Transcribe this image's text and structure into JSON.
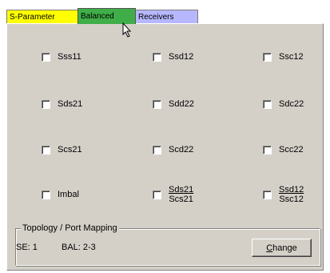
{
  "tabs": [
    {
      "label": "S-Parameter",
      "color": "#ffff00"
    },
    {
      "label": "Balanced",
      "color": "#3fae49",
      "selected": true
    },
    {
      "label": "Receivers",
      "color": "#b7b7ff"
    }
  ],
  "checkboxes": [
    {
      "label": "Sss11",
      "checked": false
    },
    {
      "label": "Ssd12",
      "checked": false
    },
    {
      "label": "Ssc12",
      "checked": false
    },
    {
      "label": "Sds21",
      "checked": false
    },
    {
      "label": "Sdd22",
      "checked": false
    },
    {
      "label": "Sdc22",
      "checked": false
    },
    {
      "label": "Scs21",
      "checked": false
    },
    {
      "label": "Scd22",
      "checked": false
    },
    {
      "label": "Scc22",
      "checked": false
    },
    {
      "label": "Imbal",
      "checked": false
    },
    {
      "numerator": "Sds21",
      "denominator": "Scs21",
      "checked": false
    },
    {
      "numerator": "Ssd12",
      "denominator": "Ssc12",
      "checked": false
    }
  ],
  "topology": {
    "legend": "Topology / Port Mapping",
    "se_label": "SE: 1",
    "bal_label": "BAL: 2-3",
    "change_button": "Change",
    "change_mnemonic": "C"
  }
}
